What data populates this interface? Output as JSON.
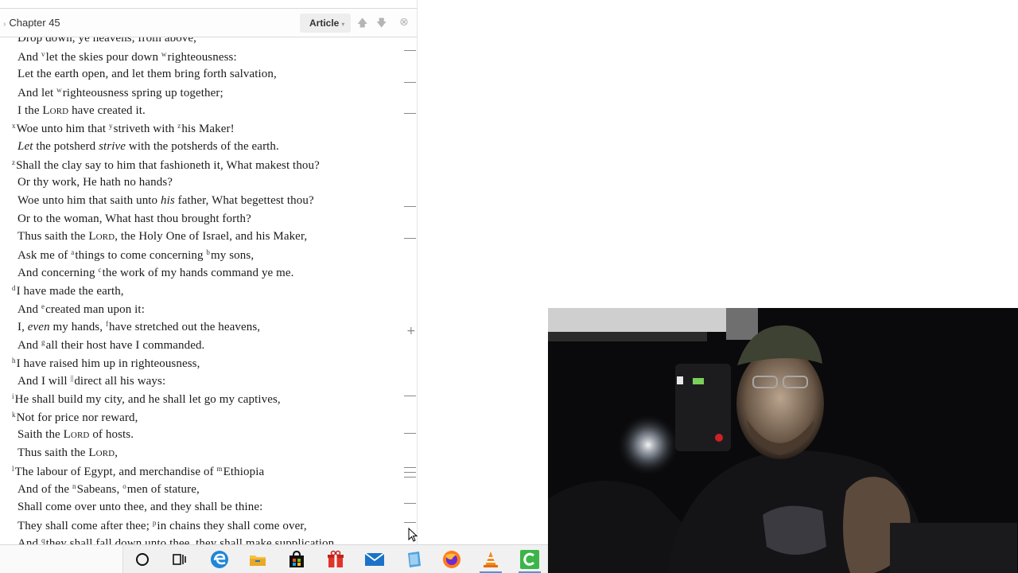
{
  "reader": {
    "chapter_title": "Chapter 45",
    "view_mode": "Article",
    "lines": [
      {
        "sup": "",
        "parts": [
          {
            "t": "Drop down, ye heavens, from above,"
          }
        ]
      },
      {
        "sup": "",
        "parts": [
          {
            "t": "And "
          },
          {
            "s": "v"
          },
          {
            "t": "let the skies pour down "
          },
          {
            "s": "w"
          },
          {
            "t": "righteousness:"
          }
        ]
      },
      {
        "sup": "",
        "parts": [
          {
            "t": "Let the earth open, and let them bring forth salvation,"
          }
        ]
      },
      {
        "sup": "",
        "parts": [
          {
            "t": "And let "
          },
          {
            "s": "w"
          },
          {
            "t": "righteousness spring up together;"
          }
        ]
      },
      {
        "sup": "",
        "parts": [
          {
            "t": "I the "
          },
          {
            "sc": "Lord"
          },
          {
            "t": " have created it."
          }
        ]
      },
      {
        "sup": "x",
        "parts": [
          {
            "t": "Woe unto him that "
          },
          {
            "s": "y"
          },
          {
            "t": "striveth with "
          },
          {
            "s": "z"
          },
          {
            "t": "his Maker!"
          }
        ]
      },
      {
        "sup": "",
        "parts": [
          {
            "i": "Let"
          },
          {
            "t": " the potsherd "
          },
          {
            "i": "strive"
          },
          {
            "t": " with the potsherds of the earth."
          }
        ]
      },
      {
        "sup": "z",
        "parts": [
          {
            "t": "Shall the clay say to him that fashioneth it, What makest thou?"
          }
        ]
      },
      {
        "sup": "",
        "parts": [
          {
            "t": "Or thy work, He hath no hands?"
          }
        ]
      },
      {
        "sup": "",
        "parts": [
          {
            "t": "Woe unto him that saith unto "
          },
          {
            "i": "his"
          },
          {
            "t": " father, What begettest thou?"
          }
        ]
      },
      {
        "sup": "",
        "parts": [
          {
            "t": "Or to the woman, What hast thou brought forth?"
          }
        ]
      },
      {
        "sup": "",
        "parts": [
          {
            "t": "Thus saith the "
          },
          {
            "sc": "Lord"
          },
          {
            "t": ", the Holy One of Israel, and his Maker,"
          }
        ]
      },
      {
        "sup": "",
        "parts": [
          {
            "t": "Ask me of "
          },
          {
            "s": "a"
          },
          {
            "t": "things to come concerning "
          },
          {
            "s": "b"
          },
          {
            "t": "my sons,"
          }
        ]
      },
      {
        "sup": "",
        "parts": [
          {
            "t": "And concerning "
          },
          {
            "s": "c"
          },
          {
            "t": "the work of my hands command ye me."
          }
        ]
      },
      {
        "sup": "d",
        "parts": [
          {
            "t": "I have made the earth,"
          }
        ]
      },
      {
        "sup": "",
        "parts": [
          {
            "t": "And "
          },
          {
            "s": "e"
          },
          {
            "t": "created man upon it:"
          }
        ]
      },
      {
        "sup": "",
        "parts": [
          {
            "t": "I, "
          },
          {
            "i": "even"
          },
          {
            "t": " my hands, "
          },
          {
            "s": "f"
          },
          {
            "t": "have stretched out the heavens,"
          }
        ]
      },
      {
        "sup": "",
        "parts": [
          {
            "t": "And "
          },
          {
            "s": "g"
          },
          {
            "t": "all their host have I commanded."
          }
        ]
      },
      {
        "sup": "h",
        "parts": [
          {
            "t": "I have raised him up in righteousness,"
          }
        ]
      },
      {
        "sup": "",
        "parts": [
          {
            "t": "And I will "
          },
          {
            "s": "||"
          },
          {
            "t": "direct all his ways:"
          }
        ]
      },
      {
        "sup": "i",
        "parts": [
          {
            "t": "He shall build my city, and he shall let go my captives,"
          }
        ]
      },
      {
        "sup": "k",
        "parts": [
          {
            "t": "Not for price nor reward,"
          }
        ]
      },
      {
        "sup": "",
        "parts": [
          {
            "t": "Saith the "
          },
          {
            "sc": "Lord"
          },
          {
            "t": " of hosts."
          }
        ]
      },
      {
        "sup": "",
        "parts": [
          {
            "t": "Thus saith the "
          },
          {
            "sc": "Lord"
          },
          {
            "t": ","
          }
        ]
      },
      {
        "sup": "l",
        "parts": [
          {
            "t": "The labour of Egypt, and merchandise of "
          },
          {
            "s": "m"
          },
          {
            "t": "Ethiopia"
          }
        ]
      },
      {
        "sup": "",
        "parts": [
          {
            "t": "And of the "
          },
          {
            "s": "n"
          },
          {
            "t": "Sabeans, "
          },
          {
            "s": "o"
          },
          {
            "t": "men of stature,"
          }
        ]
      },
      {
        "sup": "",
        "parts": [
          {
            "t": "Shall come over unto thee, and they shall be thine:"
          }
        ]
      },
      {
        "sup": "",
        "parts": [
          {
            "t": "They shall come after thee; "
          },
          {
            "s": "p"
          },
          {
            "t": "in chains they shall come over,"
          }
        ]
      },
      {
        "sup": "",
        "parts": [
          {
            "t": "And "
          },
          {
            "s": "q"
          },
          {
            "t": "they shall fall down unto thee, they shall make supplication"
          }
        ]
      }
    ]
  },
  "taskbar": {
    "icons": [
      "cortana-icon",
      "task-view-icon",
      "edge-icon",
      "file-explorer-icon",
      "store-icon",
      "gift-icon",
      "mail-icon",
      "app-icon",
      "firefox-icon",
      "vlc-icon",
      "green-app-icon"
    ]
  },
  "colors": {
    "accent": "#2f6db5",
    "text": "#1b1b1b",
    "taskbar": "#f1f1f1"
  }
}
